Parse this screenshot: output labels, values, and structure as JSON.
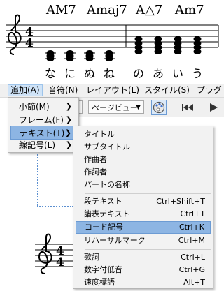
{
  "score_top": {
    "chords": [
      {
        "label": "AM7"
      },
      {
        "label": "Amaj7"
      },
      {
        "label": "A△7"
      },
      {
        "label": "Am7"
      }
    ],
    "time_signature": {
      "num": "4",
      "den": "4"
    },
    "lyrics": [
      "な",
      "に",
      "ぬ",
      "ね",
      "の",
      "あ",
      "い",
      "う"
    ]
  },
  "menubar": {
    "items": [
      {
        "label": "追加(A)",
        "active": true
      },
      {
        "label": "音符(N)"
      },
      {
        "label": "レイアウト(L)"
      },
      {
        "label": "スタイル(S)"
      },
      {
        "label": "プラグ"
      }
    ]
  },
  "toolbar": {
    "view_select": "ページビュー"
  },
  "add_menu": {
    "items": [
      {
        "label": "小節(M)"
      },
      {
        "label": "フレーム(F)"
      },
      {
        "label": "テキスト(T)",
        "highlighted": true
      },
      {
        "label": "線記号(L)"
      }
    ]
  },
  "text_submenu": {
    "items": [
      {
        "label": "タイトル",
        "shortcut": ""
      },
      {
        "label": "サブタイトル",
        "shortcut": ""
      },
      {
        "label": "作曲者",
        "shortcut": ""
      },
      {
        "label": "作詞者",
        "shortcut": ""
      },
      {
        "label": "パートの名称",
        "shortcut": ""
      },
      {
        "label": "段テキスト",
        "shortcut": "Ctrl+Shift+T"
      },
      {
        "label": "譜表テキスト",
        "shortcut": "Ctrl+T"
      },
      {
        "label": "コード記号",
        "shortcut": "Ctrl+K",
        "highlighted": true
      },
      {
        "label": "リハーサルマーク",
        "shortcut": "Ctrl+M"
      },
      {
        "label": "歌詞",
        "shortcut": "Ctrl+L"
      },
      {
        "label": "数字付低音",
        "shortcut": "Ctrl+G"
      },
      {
        "label": "速度標語",
        "shortcut": "Alt+T"
      }
    ]
  },
  "score_bottom": {
    "time_signature": {
      "num": "4",
      "den": "4"
    }
  },
  "colors": {
    "highlight": "#8db5e3",
    "menubar": "#f0f0f0",
    "menu_bg": "#f2f2f2",
    "selection_dots": "#5b8fd0"
  },
  "icons": [
    "chevron-right-icon",
    "chevron-down-icon",
    "palette-icon",
    "skip-to-start-icon",
    "play-icon"
  ]
}
